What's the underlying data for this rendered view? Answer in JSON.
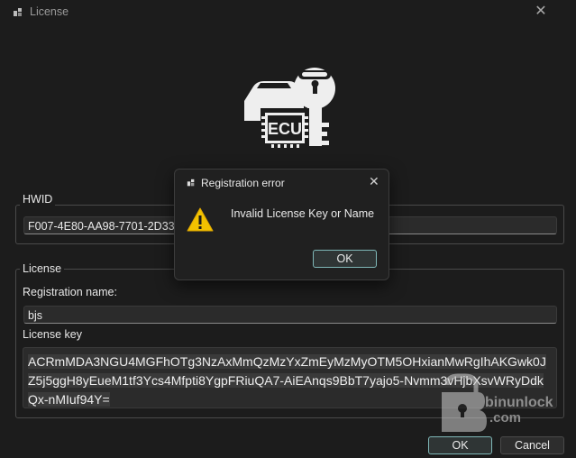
{
  "window": {
    "title": "License",
    "close_glyph": "✕"
  },
  "logo": {
    "text": "ECU",
    "icon": "car-ecu-key-logo"
  },
  "hwid": {
    "group_label": "HWID",
    "value": "F007-4E80-AA98-7701-2D33"
  },
  "license": {
    "group_label": "License",
    "name_label": "Registration name:",
    "name_value": "bjs",
    "key_label": "License key",
    "key_value": "ACRmMDA3NGU4MGFhOTg3NzAxMmQzMzYxZmEyMzMyOTM5OHxianMwRgIhAKGwk0JZ5j5ggH8yEueM1tf3Ycs4Mfpti8YgpFRiuQA7-AiEAnqs9BbT7yajo5-Nvmm3vHjbXsvWRyDdkQx-nMIuf94Y="
  },
  "buttons": {
    "ok": "OK",
    "cancel": "Cancel"
  },
  "dialog": {
    "title": "Registration error",
    "close_glyph": "✕",
    "message": "Invalid License Key or Name",
    "ok": "OK",
    "icon": "warning-icon"
  },
  "watermark": {
    "line1": "binunlock",
    "line2": ".com"
  },
  "colors": {
    "background": "#1c1c1c",
    "accent_border": "#7fb8b8",
    "warning": "#f2c200"
  }
}
